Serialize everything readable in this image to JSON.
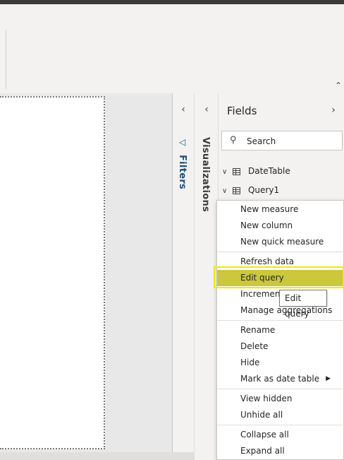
{
  "ribbon": {
    "collapse_icon": "chevron-up-icon"
  },
  "filters_pane": {
    "collapse_icon": "chevron-left-icon",
    "icon": "filter-icon",
    "label": "Filters"
  },
  "visualizations_pane": {
    "collapse_icon": "chevron-left-icon",
    "label": "Visualizations"
  },
  "fields_pane": {
    "title": "Fields",
    "expand_icon": "chevron-right-icon",
    "search": {
      "placeholder": "Search",
      "icon": "search-icon"
    },
    "tables": [
      {
        "name": "DateTable",
        "icon": "table-icon"
      },
      {
        "name": "Query1",
        "icon": "table-icon"
      }
    ]
  },
  "context_menu": {
    "items": [
      {
        "label": "New measure"
      },
      {
        "label": "New column"
      },
      {
        "label": "New quick measure"
      },
      {
        "label": "Refresh data"
      },
      {
        "label": "Edit query"
      },
      {
        "label": "Incremental refresh"
      },
      {
        "label": "Manage aggregations"
      },
      {
        "label": "Rename"
      },
      {
        "label": "Delete"
      },
      {
        "label": "Hide"
      },
      {
        "label": "Mark as date table"
      },
      {
        "label": "View hidden"
      },
      {
        "label": "Unhide all"
      },
      {
        "label": "Collapse all"
      },
      {
        "label": "Expand all"
      }
    ],
    "highlighted": "Edit query"
  },
  "tooltip": {
    "text": "Edit query"
  },
  "colors": {
    "highlight": "#cbc83e",
    "highlight_outline": "#f2ea00",
    "filters_accent": "#1f4e79"
  }
}
